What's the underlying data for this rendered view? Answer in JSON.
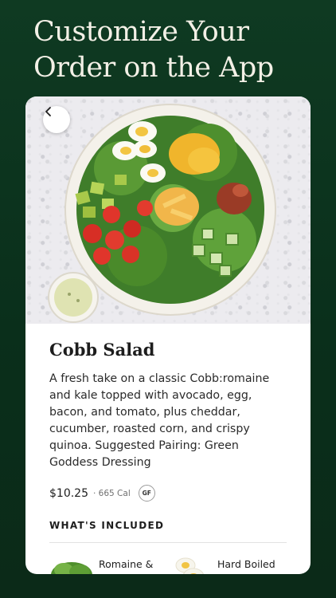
{
  "headline": "Customize Your Order on the App",
  "product": {
    "name": "Cobb Salad",
    "description": "A fresh take on a classic Cobb:romaine and kale topped with avocado, egg, bacon, and tomato, plus cheddar, cucumber, roasted corn, and crispy quinoa. Suggested Pairing: Green Goddess Dressing",
    "price": "$10.25",
    "calories": "· 665 Cal",
    "badge": "GF"
  },
  "included": {
    "label": "WHAT'S INCLUDED",
    "items": [
      {
        "label": "Romaine & Kale",
        "icon": "greens-icon"
      },
      {
        "label": "Hard Boiled Egg",
        "icon": "egg-icon"
      }
    ]
  },
  "colors": {
    "background": "#0f3a22",
    "card": "#ffffff",
    "headline": "#f3f0e6"
  }
}
